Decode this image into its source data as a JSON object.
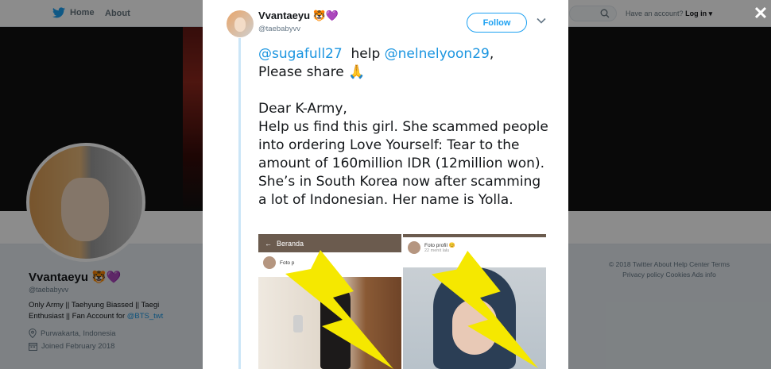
{
  "nav": {
    "home_label": "Home",
    "about_label": "About",
    "account_prompt": "Have an account?",
    "login_label": "Log in ▾"
  },
  "profile": {
    "display_name": "Vvantaeyu 🐯💜",
    "handle": "@taebabyvv",
    "bio_text": "Only Army || Taehyung Biassed || Taegi Enthusiast || Fan Account for ",
    "bio_link": "@BTS_twt",
    "location": "Purwakarta, Indonesia",
    "joined": "Joined February 2018"
  },
  "footer": {
    "line1": "© 2018 Twitter   About   Help Center   Terms",
    "line2": "Privacy policy   Cookies   Ads info"
  },
  "modal": {
    "author_name": "Vvantaeyu 🐯💜",
    "author_handle": "@taebabyvv",
    "follow_label": "Follow",
    "tweet": {
      "mention1": "@sugafull27",
      "help_word": "help",
      "mention2": "@nelnelyoon29",
      "share_line": "Please share 🙏",
      "greeting": "Dear K-Army,",
      "body": "Help us find this girl. She scammed people into ordering Love Yourself: Tear to the amount of 160million IDR (12million won). She’s in South Korea now after scamming a lot of Indonesian. Her name is Yolla."
    },
    "media": {
      "shot1_header": "Beranda",
      "shot1_post_label": "Foto p",
      "shot2_post_label": "Foto profil 😊",
      "shot2_post_sub": "22 menit lalu"
    }
  },
  "colors": {
    "twitter_blue": "#1da1f2",
    "mention_blue": "#1b95e0",
    "overlay": "rgba(0,0,0,0.45)",
    "bolt_yellow": "#f5e800"
  }
}
